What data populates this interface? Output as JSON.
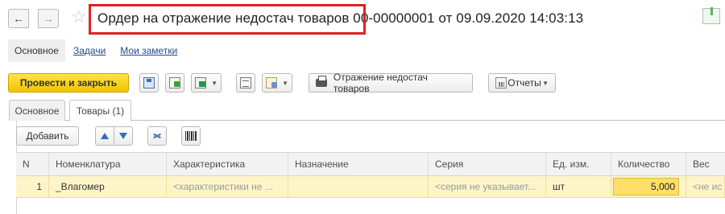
{
  "header": {
    "title": "Ордер на отражение недостач товаров 00-00000001 от 09.09.2020 14:03:13",
    "back_icon": "arrow-left-icon",
    "forward_icon": "arrow-right-icon",
    "favorite_icon": "star-icon"
  },
  "subnav": {
    "items": [
      "Основное",
      "Задачи",
      "Мои заметки"
    ]
  },
  "toolbar": {
    "post_close_label": "Провести и закрыть",
    "writeoff_label": "Отражение недостач товаров",
    "reports_label": "Отчеты"
  },
  "tabs": [
    "Основное",
    "Товары (1)"
  ],
  "table_toolbar": {
    "add_label": "Добавить"
  },
  "table": {
    "columns": [
      "N",
      "Номенклатура",
      "Характеристика",
      "Назначение",
      "Серия",
      "Ед. изм.",
      "Количество",
      "Вес"
    ],
    "rows": [
      {
        "n": "1",
        "nomenclature": "_Влагомер",
        "characteristic": "<характеристики не ...",
        "purpose": "",
        "series": "<серия не указывает...",
        "unit": "шт",
        "quantity": "5,000",
        "weight": "<не ис"
      }
    ]
  },
  "colors": {
    "accent_yellow": "#f2c400",
    "row_highlight": "#fdf5c8",
    "annotation_red": "#e02020"
  }
}
